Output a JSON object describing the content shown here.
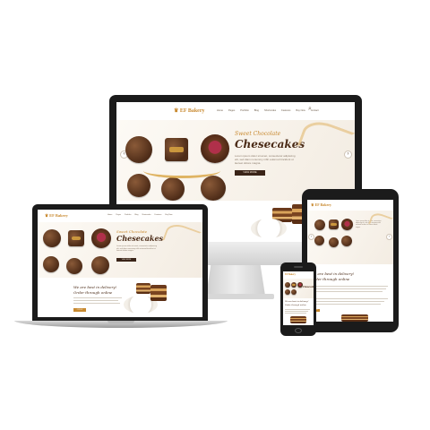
{
  "site": {
    "logo": "♛ EF Bakery",
    "logo_short": "EF Bakery",
    "nav": [
      "Home",
      "Pages",
      "Portfolio",
      "Blog",
      "Shortcodes",
      "Features",
      "Buy Now",
      "Contact"
    ]
  },
  "hero": {
    "eyebrow": "Sweet Chocolate",
    "title": "Chesecakes",
    "description": "Lorem ipsum dolor sit amet, consectetur adipiscing elit, sed diam nonummy nibh euismod tincidunt ut laoreet dolore magna.",
    "button": "VIEW MORE"
  },
  "intro": {
    "title_line1": "We are best in delivery!",
    "title_line2": "Order through online",
    "button": "ORDER"
  },
  "icons": {
    "prev": "‹",
    "next": "›",
    "search": "⌕",
    "apple": ""
  },
  "colors": {
    "accent": "#c8892f",
    "chocolate": "#4e2c18",
    "background": "#fbf8f3"
  }
}
